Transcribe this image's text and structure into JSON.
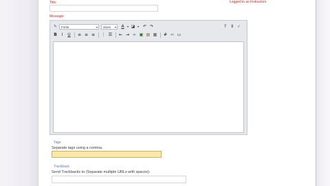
{
  "form": {
    "title_label": "Title:",
    "title_value": "",
    "logged_in_text": "Logged in as Instructors",
    "message_label": "Message:"
  },
  "toolbar": {
    "font_select": "Fonts",
    "size_select": "Sizes"
  },
  "tags": {
    "section_label": "Tags",
    "hint": "Separate tags using a comma.",
    "value": "",
    "input_color": "#fbe8a6"
  },
  "trackback": {
    "section_label": "Trackback",
    "hint": "Send Trackbacks to (Separate multiple URLs with spaces):",
    "value": ""
  },
  "colors": {
    "label_red": "#b2322a",
    "label_blue": "#5a79b4",
    "editor_bg": "#e6e8ec"
  }
}
